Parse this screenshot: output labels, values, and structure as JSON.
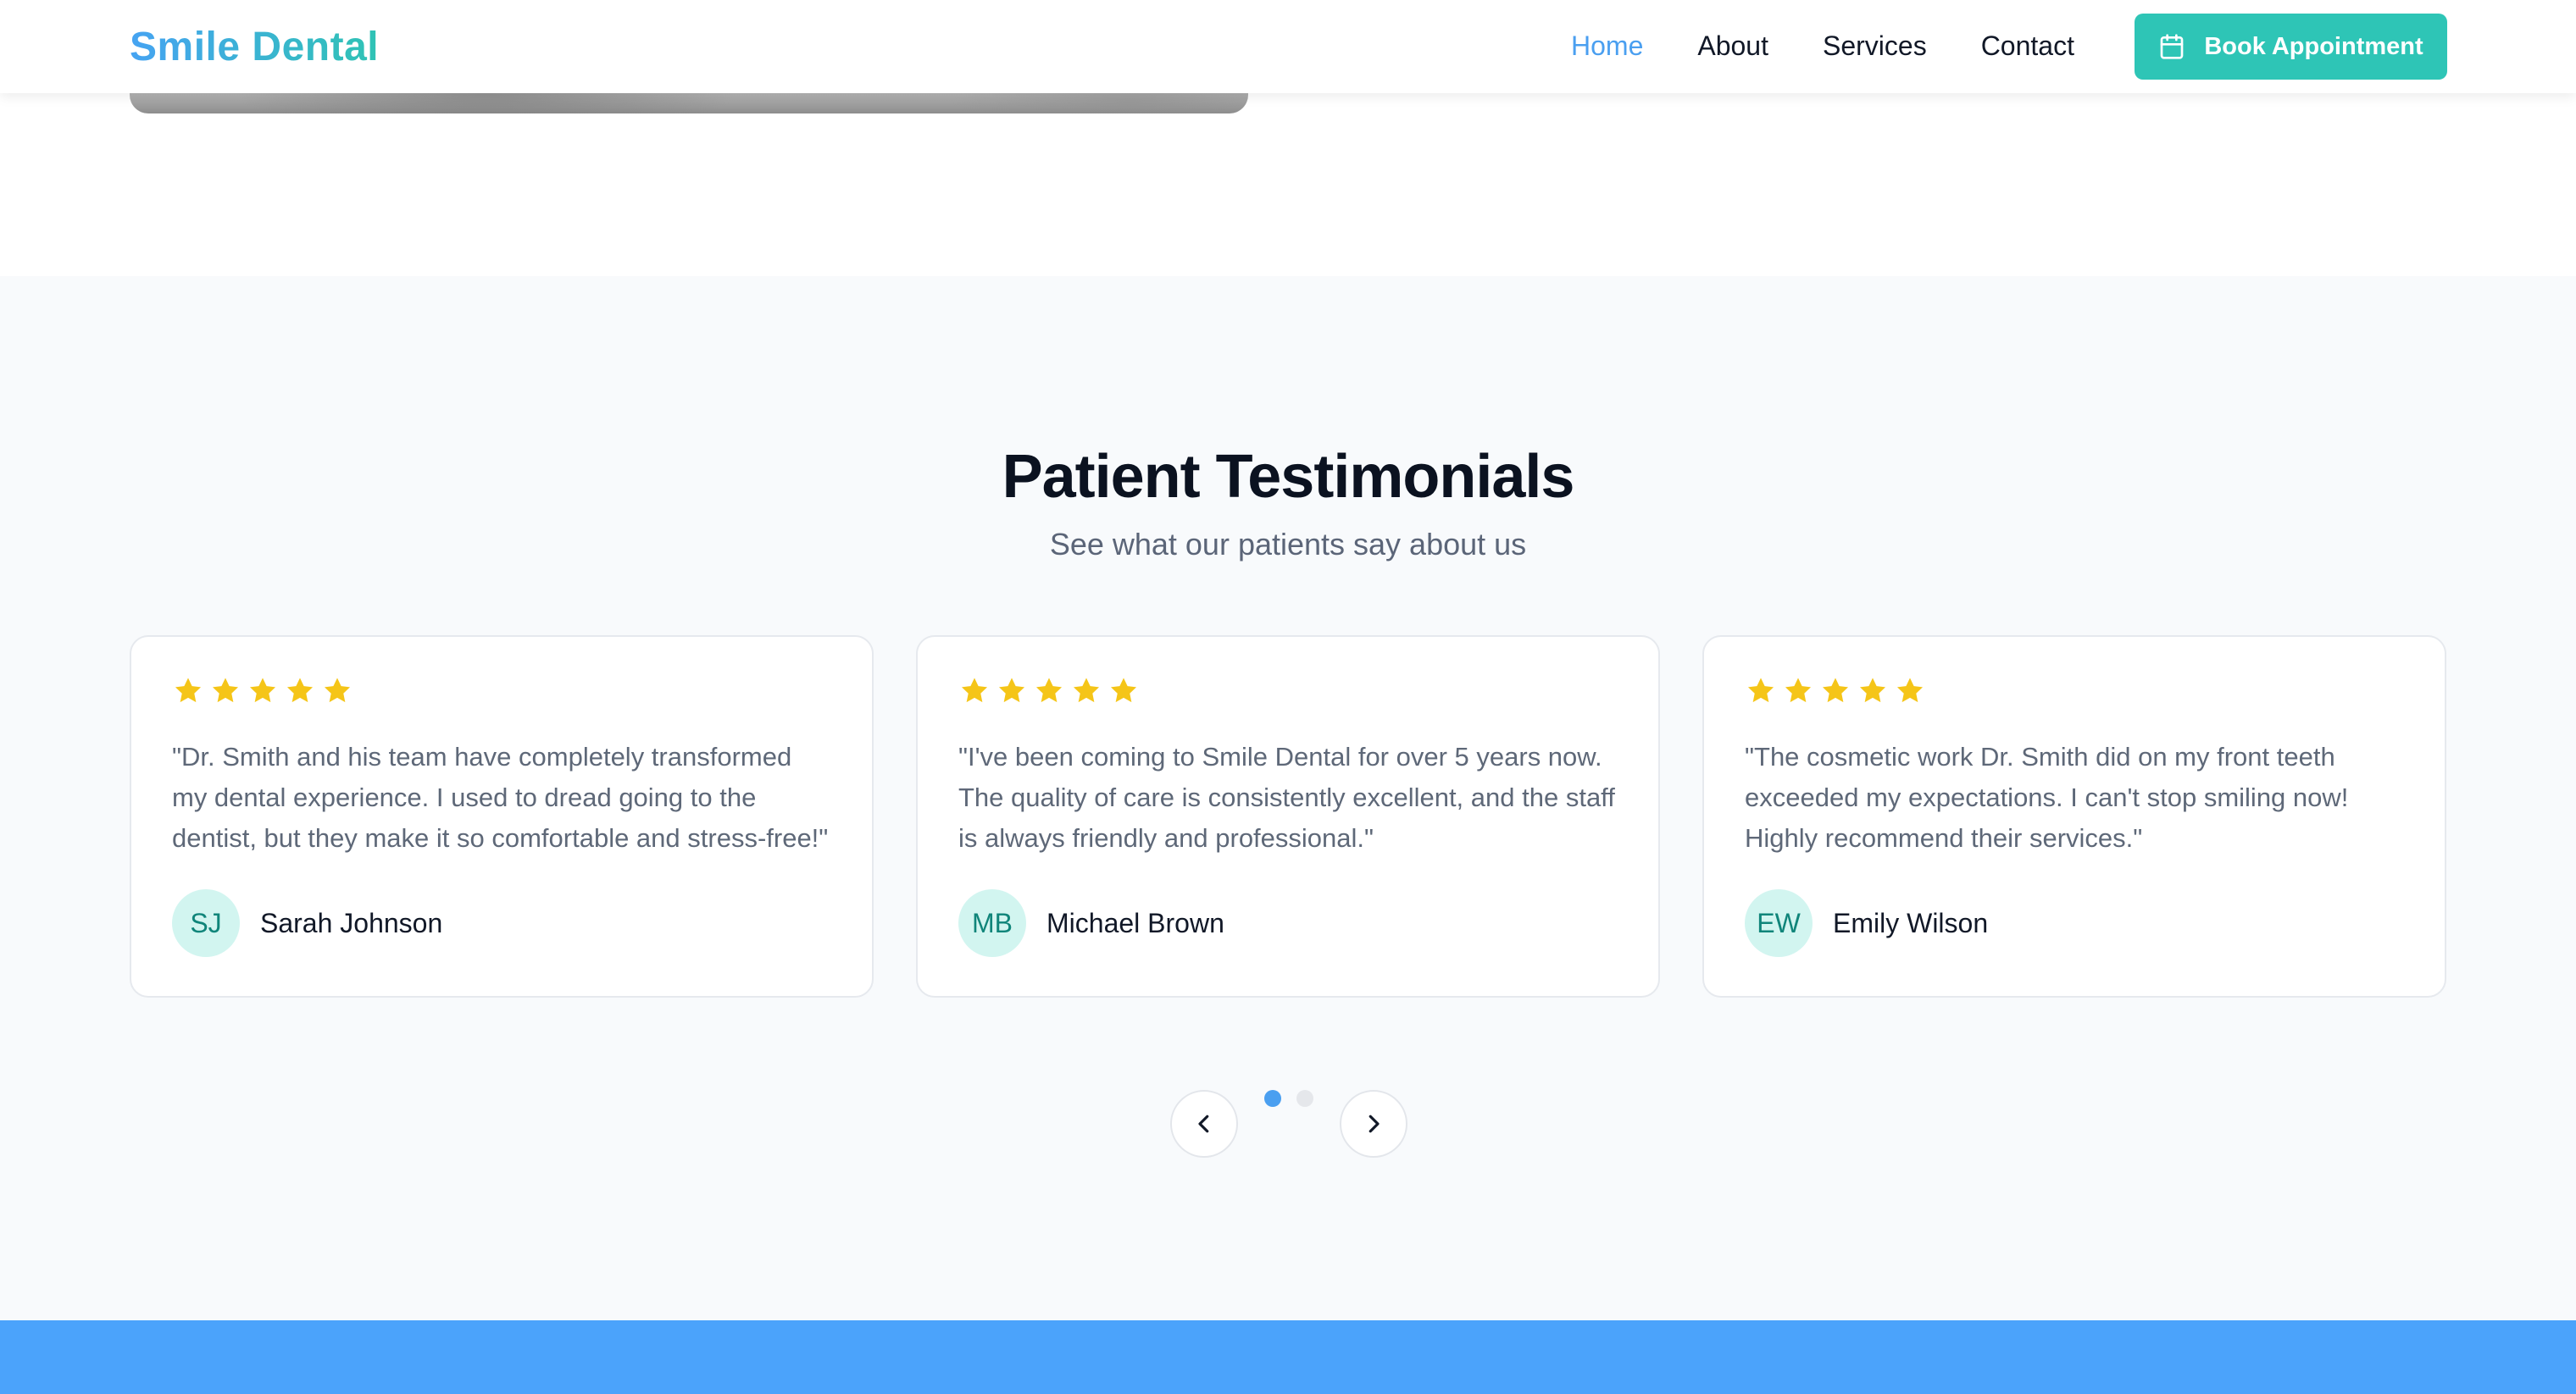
{
  "brand": {
    "name": "Smile Dental",
    "gradient_start": "#46a3f2",
    "gradient_end": "#2fc3b4"
  },
  "nav": {
    "items": [
      {
        "label": "Home",
        "active": true
      },
      {
        "label": "About",
        "active": false
      },
      {
        "label": "Services",
        "active": false
      },
      {
        "label": "Contact",
        "active": false
      }
    ],
    "cta_label": "Book Appointment",
    "cta_icon": "calendar-icon",
    "active_color": "#4a9ff0",
    "cta_color": "#2ec5b6"
  },
  "testimonials": {
    "title": "Patient Testimonials",
    "subtitle": "See what our patients say about us",
    "star_color": "#f5c518",
    "cards": [
      {
        "rating": 5,
        "quote": "\"Dr. Smith and his team have completely transformed my dental experience. I used to dread going to the dentist, but they make it so comfortable and stress-free!\"",
        "initials": "SJ",
        "name": "Sarah Johnson"
      },
      {
        "rating": 5,
        "quote": "\"I've been coming to Smile Dental for over 5 years now. The quality of care is consistently excellent, and the staff is always friendly and professional.\"",
        "initials": "MB",
        "name": "Michael Brown"
      },
      {
        "rating": 5,
        "quote": "\"The cosmetic work Dr. Smith did on my front teeth exceeded my expectations. I can't stop smiling now! Highly recommend their services.\"",
        "initials": "EW",
        "name": "Emily Wilson"
      }
    ],
    "carousel": {
      "page_count": 2,
      "active_page": 1,
      "prev_icon": "chevron-left-icon",
      "next_icon": "chevron-right-icon"
    }
  },
  "footer_band_color": "#4ba3fb"
}
